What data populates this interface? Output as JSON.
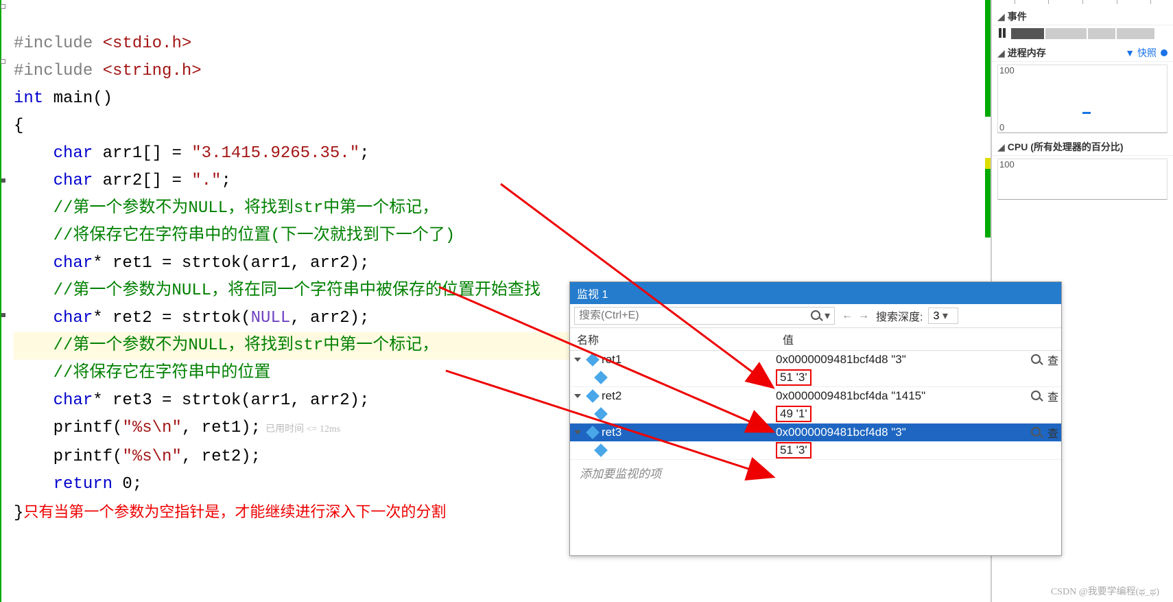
{
  "code": {
    "include1_pre": "#include ",
    "include1_hdr": "<stdio.h>",
    "include2_pre": "#include ",
    "include2_hdr": "<string.h>",
    "line3_kw": "int",
    "line3_rest": " main()",
    "line4": "{",
    "line5_pad": "    ",
    "line5_kw": "char",
    "line5_mid": " arr1[] = ",
    "line5_str": "\"3.1415.9265.35.\"",
    "line5_end": ";",
    "line6_pad": "    ",
    "line6_kw": "char",
    "line6_mid": " arr2[] = ",
    "line6_str": "\".\"",
    "line6_end": ";",
    "line7_pad": "    ",
    "line7_cm": "//第一个参数不为NULL，将找到str中第一个标记，",
    "line8_pad": "    ",
    "line8_cm": "//将保存它在字符串中的位置(下一次就找到下一个了)",
    "line9_pad": "    ",
    "line9_kw": "char",
    "line9_mid": "* ret1 = strtok(arr1, arr2);",
    "line10_pad": "    ",
    "line10_cm": "//第一个参数为NULL，将在同一个字符串中被保存的位置开始查找",
    "line11_pad": "    ",
    "line11_kw": "char",
    "line11_a": "* ret2 = strtok(",
    "line11_mac": "NULL",
    "line11_b": ", arr2);",
    "line12_pad": "    ",
    "line12_cm": "//第一个参数不为NULL，将找到str中第一个标记，",
    "line13_pad": "    ",
    "line13_cm": "//将保存它在字符串中的位置",
    "line14_pad": "    ",
    "line14_kw": "char",
    "line14_mid": "* ret3 = strtok(arr1, arr2);",
    "line15_pad": "    ",
    "line15_a": "printf(",
    "line15_str": "\"%s\\n\"",
    "line15_b": ", ret1);",
    "line15_hint": "  已用时间 <= 12ms",
    "line16_pad": "    ",
    "line16_a": "printf(",
    "line16_str": "\"%s\\n\"",
    "line16_b": ", ret2);",
    "line17_pad": "    ",
    "line17_kw": "return",
    "line17_rest": " 0;",
    "line18": "}",
    "red_note": "只有当第一个参数为空指针是，才能继续进行深入下一次的分割"
  },
  "diag": {
    "events_title": "事件",
    "procmem_title": "进程内存",
    "snapshot_label": "快照",
    "cpu_title": "CPU (所有处理器的百分比)",
    "axis_100_a": "100",
    "axis_0": "0",
    "axis_100_b": "100"
  },
  "watch": {
    "title": "监视 1",
    "search_placeholder": "搜索(Ctrl+E)",
    "depth_label": "搜索深度:",
    "depth_value": "3",
    "headers": {
      "name": "名称",
      "value": "值"
    },
    "rows": [
      {
        "name": "ret1",
        "value": "0x0000009481bcf4d8 \"3\"",
        "child": "51 '3'",
        "selected": false
      },
      {
        "name": "ret2",
        "value": "0x0000009481bcf4da \"1415\"",
        "child": "49 '1'",
        "selected": false
      },
      {
        "name": "ret3",
        "value": "0x0000009481bcf4d8 \"3\"",
        "child": "51 '3'",
        "selected": true
      }
    ],
    "placeholder": "添加要监视的项",
    "view_btn": "查"
  },
  "watermark": "CSDN @我要学编程(ಥ_ಥ)"
}
